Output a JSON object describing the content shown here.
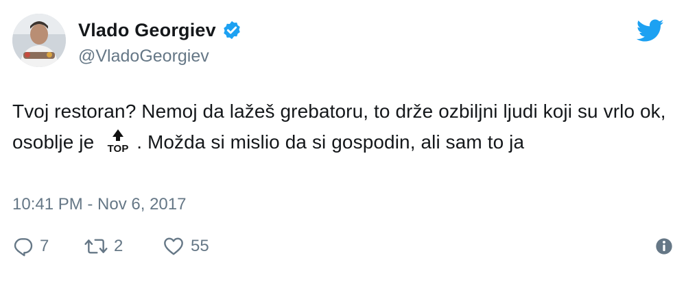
{
  "author": {
    "display_name": "Vlado Georgiev",
    "handle": "@VladoGeorgiev",
    "verified": true,
    "avatar_icon": "profile-photo"
  },
  "tweet": {
    "text_part1": "Tvoj restoran? Nemoj da lažeš grebatoru, to drže ozbiljni ljudi koji su vrlo ok, osoblje je",
    "emoji_label": "TOP",
    "text_part2": ". Možda si mislio da si gospodin, ali sam to ja",
    "timestamp": "10:41 PM - Nov 6, 2017"
  },
  "actions": {
    "reply_count": "7",
    "retweet_count": "2",
    "like_count": "55"
  },
  "icons": {
    "brand": "twitter-bird-icon",
    "verified": "verified-badge-icon",
    "reply": "reply-icon",
    "retweet": "retweet-icon",
    "like": "heart-icon",
    "info": "info-icon"
  },
  "colors": {
    "brand_blue": "#1da1f2",
    "secondary_text": "#657786",
    "primary_text": "#14171a"
  }
}
